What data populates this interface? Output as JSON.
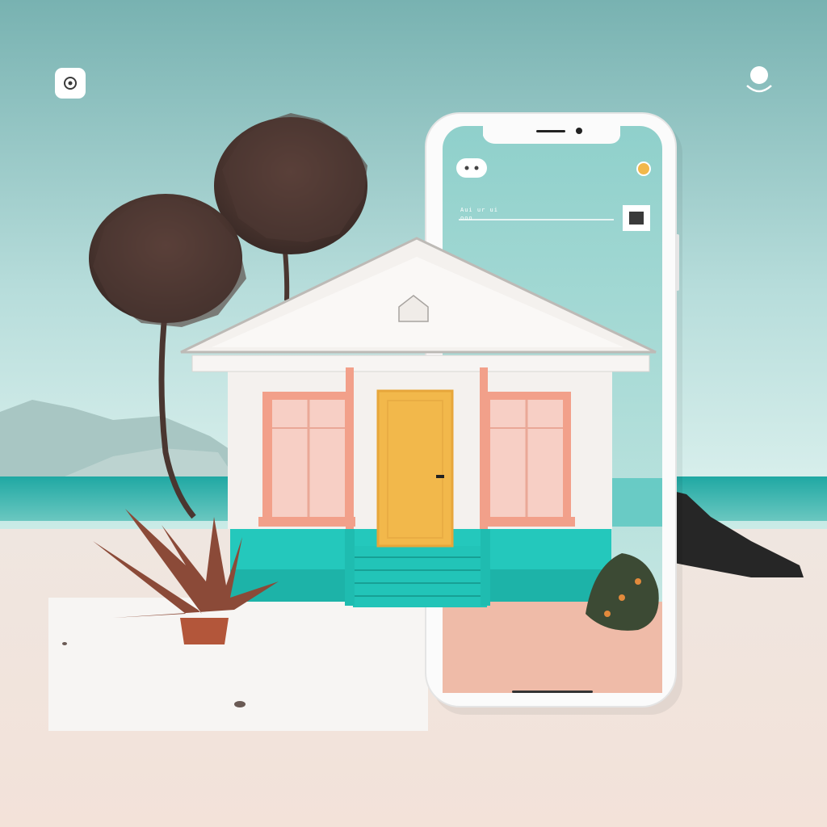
{
  "scene": {
    "description_colors": {
      "sky_top": "#7fb8b6",
      "sky_bottom": "#cfe9e6",
      "sea": "#2fb7b0",
      "sand": "#efe2da",
      "phone_frame": "#ffffff",
      "phone_screen_sky": "#9fd6d2",
      "phone_floor": "#efb9a6",
      "house_wall": "#f3efec",
      "house_base": "#22cbbf",
      "trim_pink": "#f2a08a",
      "door": "#f2b84b",
      "palm_fronds": "#5a4039",
      "plant_leaves": "#8b4a38",
      "rocks": "#2a2a2a"
    }
  },
  "ui": {
    "top_left_icon": "camera-icon",
    "top_right_icon": "user-icon"
  },
  "phone": {
    "status_icon": "toggle-pill-icon",
    "status_dot_color": "#f2b84b",
    "text_line_1": "Aui ur ui",
    "text_line_2": "ooo"
  }
}
